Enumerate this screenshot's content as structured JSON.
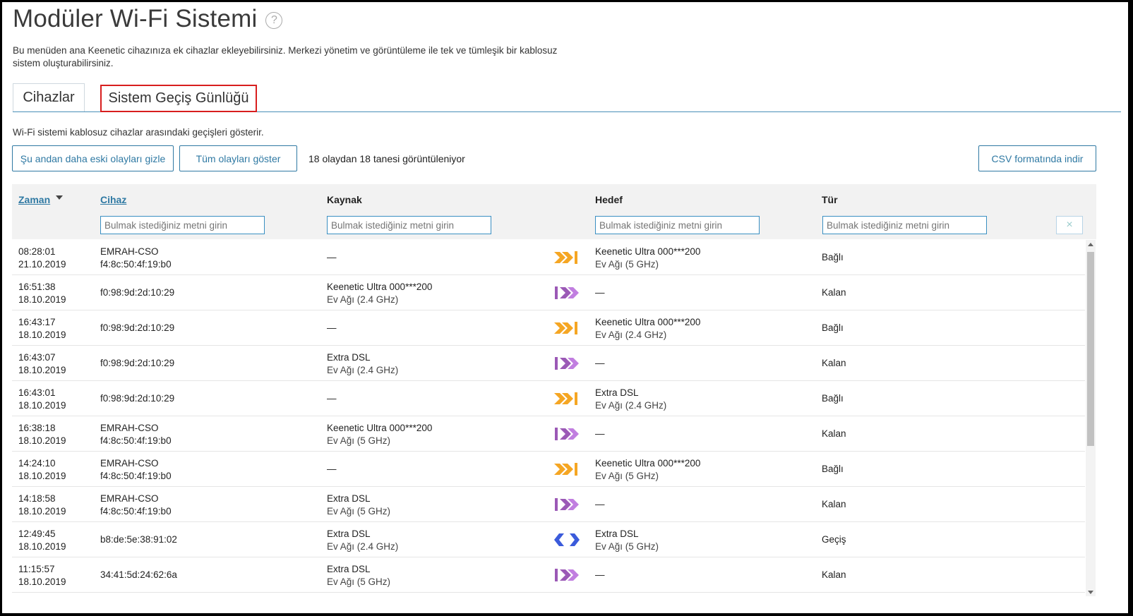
{
  "page": {
    "title": "Modüler Wi-Fi Sistemi",
    "help_icon": "?",
    "description": "Bu menüden ana Keenetic cihazınıza ek cihazlar ekleyebilirsiniz. Merkezi yönetim ve görüntüleme ile tek ve tümleşik bir kablosuz sistem oluşturabilirsiniz."
  },
  "tabs": [
    {
      "label": "Cihazlar",
      "active": false
    },
    {
      "label": "Sistem Geçiş Günlüğü",
      "active": true,
      "highlighted": true
    }
  ],
  "log": {
    "description": "Wi-Fi sistemi kablosuz cihazlar arasındaki geçişleri gösterir.",
    "hide_old_button": "Şu andan daha eski olayları gizle",
    "show_all_button": "Tüm olayları göster",
    "count_text": "18 olaydan 18 tanesi görüntüleniyor",
    "csv_button": "CSV formatında indir"
  },
  "table": {
    "columns": {
      "time": "Zaman",
      "device": "Cihaz",
      "source": "Kaynak",
      "target": "Hedef",
      "type": "Tür"
    },
    "filter_placeholder": "Bulmak istediğiniz metni girin",
    "clear_icon": "×",
    "rows": [
      {
        "time": "08:28:01",
        "date": "21.10.2019",
        "device": "EMRAH-CSO",
        "mac": "f4:8c:50:4f:19:b0",
        "src": "—",
        "src_net": "",
        "dir": "connected",
        "dst": "Keenetic Ultra 000***200",
        "dst_net": "Ev Ağı (5 GHz)",
        "type": "Bağlı"
      },
      {
        "time": "16:51:38",
        "date": "18.10.2019",
        "device": "f0:98:9d:2d:10:29",
        "mac": "",
        "src": "Keenetic Ultra 000***200",
        "src_net": "Ev Ağı (2.4 GHz)",
        "dir": "left",
        "dst": "—",
        "dst_net": "",
        "type": "Kalan"
      },
      {
        "time": "16:43:17",
        "date": "18.10.2019",
        "device": "f0:98:9d:2d:10:29",
        "mac": "",
        "src": "—",
        "src_net": "",
        "dir": "connected",
        "dst": "Keenetic Ultra 000***200",
        "dst_net": "Ev Ağı (2.4 GHz)",
        "type": "Bağlı"
      },
      {
        "time": "16:43:07",
        "date": "18.10.2019",
        "device": "f0:98:9d:2d:10:29",
        "mac": "",
        "src": "Extra DSL",
        "src_net": "Ev Ağı (2.4 GHz)",
        "dir": "left",
        "dst": "—",
        "dst_net": "",
        "type": "Kalan"
      },
      {
        "time": "16:43:01",
        "date": "18.10.2019",
        "device": "f0:98:9d:2d:10:29",
        "mac": "",
        "src": "—",
        "src_net": "",
        "dir": "connected",
        "dst": "Extra DSL",
        "dst_net": "Ev Ağı (2.4 GHz)",
        "type": "Bağlı"
      },
      {
        "time": "16:38:18",
        "date": "18.10.2019",
        "device": "EMRAH-CSO",
        "mac": "f4:8c:50:4f:19:b0",
        "src": "Keenetic Ultra 000***200",
        "src_net": "Ev Ağı (5 GHz)",
        "dir": "left",
        "dst": "—",
        "dst_net": "",
        "type": "Kalan"
      },
      {
        "time": "14:24:10",
        "date": "18.10.2019",
        "device": "EMRAH-CSO",
        "mac": "f4:8c:50:4f:19:b0",
        "src": "—",
        "src_net": "",
        "dir": "connected",
        "dst": "Keenetic Ultra 000***200",
        "dst_net": "Ev Ağı (5 GHz)",
        "type": "Bağlı"
      },
      {
        "time": "14:18:58",
        "date": "18.10.2019",
        "device": "EMRAH-CSO",
        "mac": "f4:8c:50:4f:19:b0",
        "src": "Extra DSL",
        "src_net": "Ev Ağı (5 GHz)",
        "dir": "left",
        "dst": "—",
        "dst_net": "",
        "type": "Kalan"
      },
      {
        "time": "12:49:45",
        "date": "18.10.2019",
        "device": "b8:de:5e:38:91:02",
        "mac": "",
        "src": "Extra DSL",
        "src_net": "Ev Ağı (2.4 GHz)",
        "dir": "roam",
        "dst": "Extra DSL",
        "dst_net": "Ev Ağı (5 GHz)",
        "type": "Geçiş"
      },
      {
        "time": "11:15:57",
        "date": "18.10.2019",
        "device": "34:41:5d:24:62:6a",
        "mac": "",
        "src": "Extra DSL",
        "src_net": "Ev Ağı (5 GHz)",
        "dir": "left",
        "dst": "—",
        "dst_net": "",
        "type": "Kalan"
      }
    ]
  },
  "colors": {
    "accent": "#2f79a3",
    "tab_highlight": "#d81e1e",
    "connected_arrow": "#f5a623",
    "left_arrow": "#9b59b6",
    "roam_arrow": "#3b5bdb"
  }
}
